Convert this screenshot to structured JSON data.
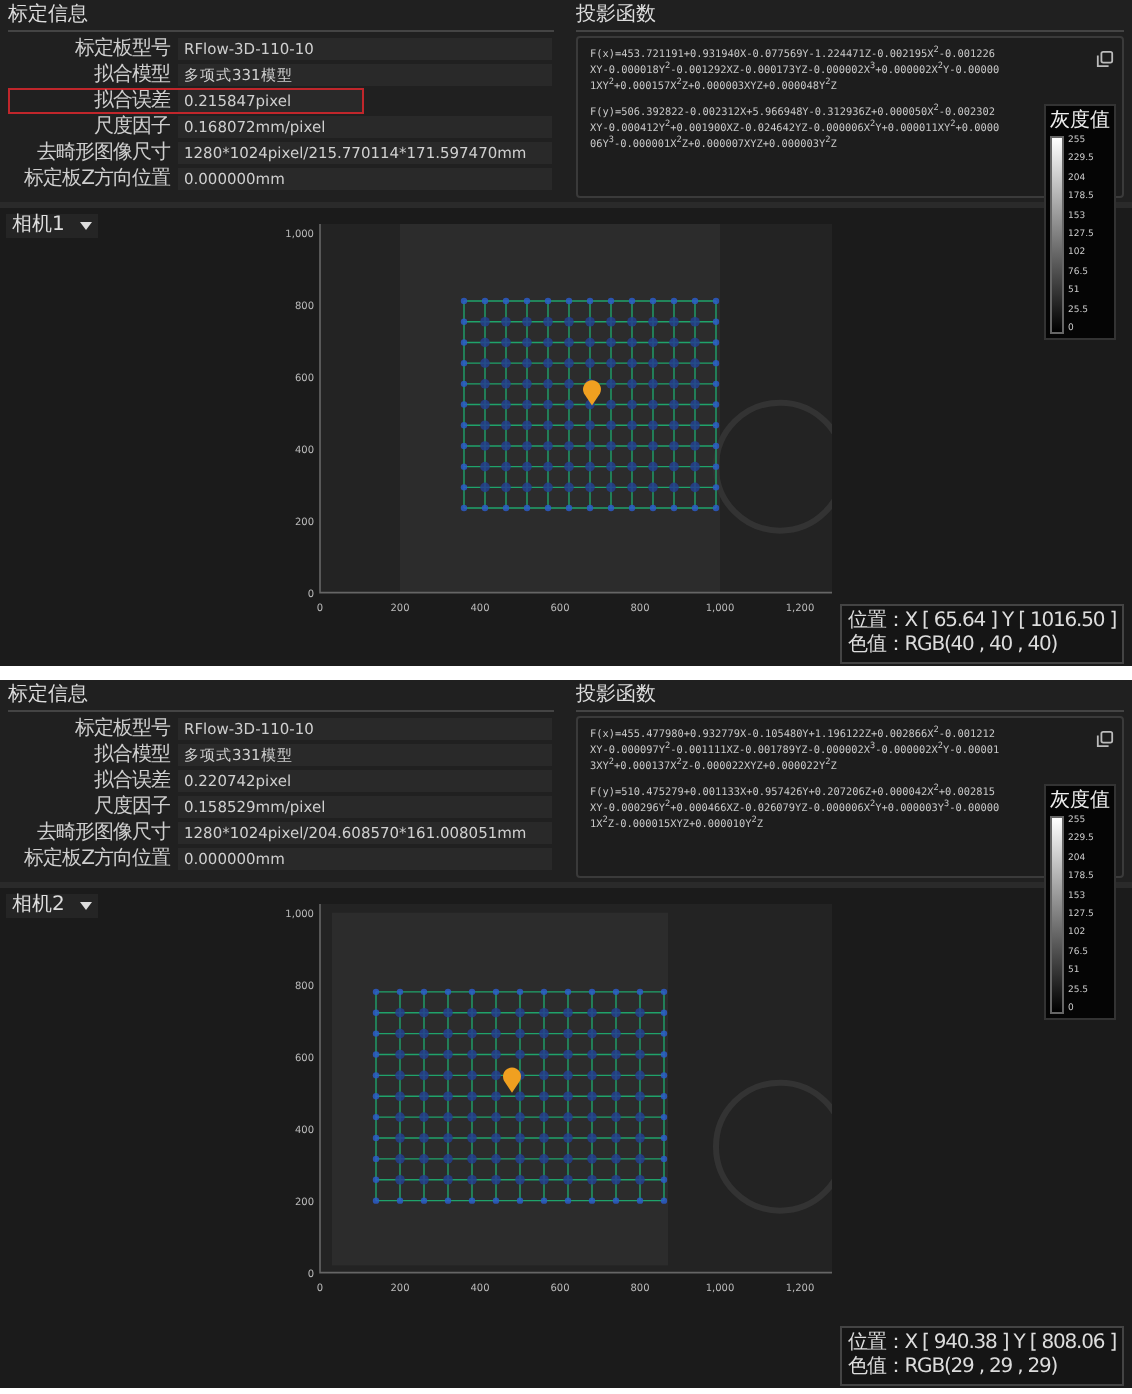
{
  "panels": [
    {
      "info": {
        "title": "标定信息",
        "rows": [
          {
            "label": "标定板型号",
            "value": "RFlow-3D-110-10",
            "highlighted": false
          },
          {
            "label": "拟合模型",
            "value": "多项式331模型",
            "highlighted": false
          },
          {
            "label": "拟合误差",
            "value": "0.215847pixel",
            "highlighted": true
          },
          {
            "label": "尺度因子",
            "value": "0.168072mm/pixel",
            "highlighted": false
          },
          {
            "label": "去畸形图像尺寸",
            "value": "1280*1024pixel/215.770114*171.597470mm",
            "highlighted": false
          },
          {
            "label": "标定板Z方向位置",
            "value": "0.000000mm",
            "highlighted": false
          }
        ]
      },
      "projection": {
        "title": "投影函数",
        "formulas": [
          "F(x)=453.721191+0.931940X-0.077569Y-1.224471Z-0.002195X$^{2}$-0.001226XY-0.000018Y$^{2}$-0.001292XZ-0.000173YZ-0.000002X$^{3}$+0.000002X$^{2}$Y-0.000001XY$^{2}$+0.000157X$^{2}$Z+0.000003XYZ+0.000048Y$^{2}$Z",
          "F(y)=506.392822-0.002312X+5.966948Y-0.312936Z+0.000050X$^{2}$-0.002302XY-0.000412Y$^{2}$+0.001900XZ-0.024642YZ-0.000006X$^{2}$Y+0.000011XY$^{2}$+0.000006Y$^{3}$-0.000001X$^{2}$Z+0.000007XYZ+0.000003Y$^{2}$Z"
        ]
      },
      "camera": "相机1",
      "colorbar": {
        "title": "灰度值",
        "ticks": [
          "255",
          "229.5",
          "204",
          "178.5",
          "153",
          "127.5",
          "102",
          "76.5",
          "51",
          "25.5",
          "0"
        ]
      },
      "axes": {
        "xticks": [
          "0",
          "200",
          "400",
          "600",
          "800",
          "1,000",
          "1,200"
        ],
        "yticks": [
          "1,000",
          "800",
          "600",
          "400",
          "200",
          "0"
        ]
      },
      "status": {
        "position": "位置：X [ 65.64 ] Y [ 1016.50 ]",
        "color_value": "色值：RGB(40 , 40 , 40)"
      }
    },
    {
      "info": {
        "title": "标定信息",
        "rows": [
          {
            "label": "标定板型号",
            "value": "RFlow-3D-110-10",
            "highlighted": false
          },
          {
            "label": "拟合模型",
            "value": "多项式331模型",
            "highlighted": false
          },
          {
            "label": "拟合误差",
            "value": "0.220742pixel",
            "highlighted": false
          },
          {
            "label": "尺度因子",
            "value": "0.158529mm/pixel",
            "highlighted": false
          },
          {
            "label": "去畸形图像尺寸",
            "value": "1280*1024pixel/204.608570*161.008051mm",
            "highlighted": false
          },
          {
            "label": "标定板Z方向位置",
            "value": "0.000000mm",
            "highlighted": false
          }
        ]
      },
      "projection": {
        "title": "投影函数",
        "formulas": [
          "F(x)=455.477980+0.932779X-0.105480Y+1.196122Z+0.002866X$^{2}$-0.001212XY-0.000097Y$^{2}$-0.001111XZ-0.001789YZ-0.000002X$^{3}$-0.000002X$^{2}$Y-0.000013XY$^{2}$+0.000137X$^{2}$Z-0.000022XYZ+0.000022Y$^{2}$Z",
          "F(y)=510.475279+0.001133X+0.957426Y+0.207206Z+0.000042X$^{2}$+0.002815XY-0.000296Y$^{2}$+0.000466XZ-0.026079YZ-0.000006X$^{2}$Y+0.000003Y$^{3}$-0.000001X$^{2}$Z-0.000015XYZ+0.000010Y$^{2}$Z"
        ]
      },
      "camera": "相机2",
      "colorbar": {
        "title": "灰度值",
        "ticks": [
          "255",
          "229.5",
          "204",
          "178.5",
          "153",
          "127.5",
          "102",
          "76.5",
          "51",
          "25.5",
          "0"
        ]
      },
      "axes": {
        "xticks": [
          "0",
          "200",
          "400",
          "600",
          "800",
          "1,000",
          "1,200"
        ],
        "yticks": [
          "1,000",
          "800",
          "600",
          "400",
          "200",
          "0"
        ]
      },
      "status": {
        "position": "位置：X [ 940.38 ] Y [ 808.06 ]",
        "color_value": "色值：RGB(29 , 29 , 29)"
      }
    }
  ]
}
